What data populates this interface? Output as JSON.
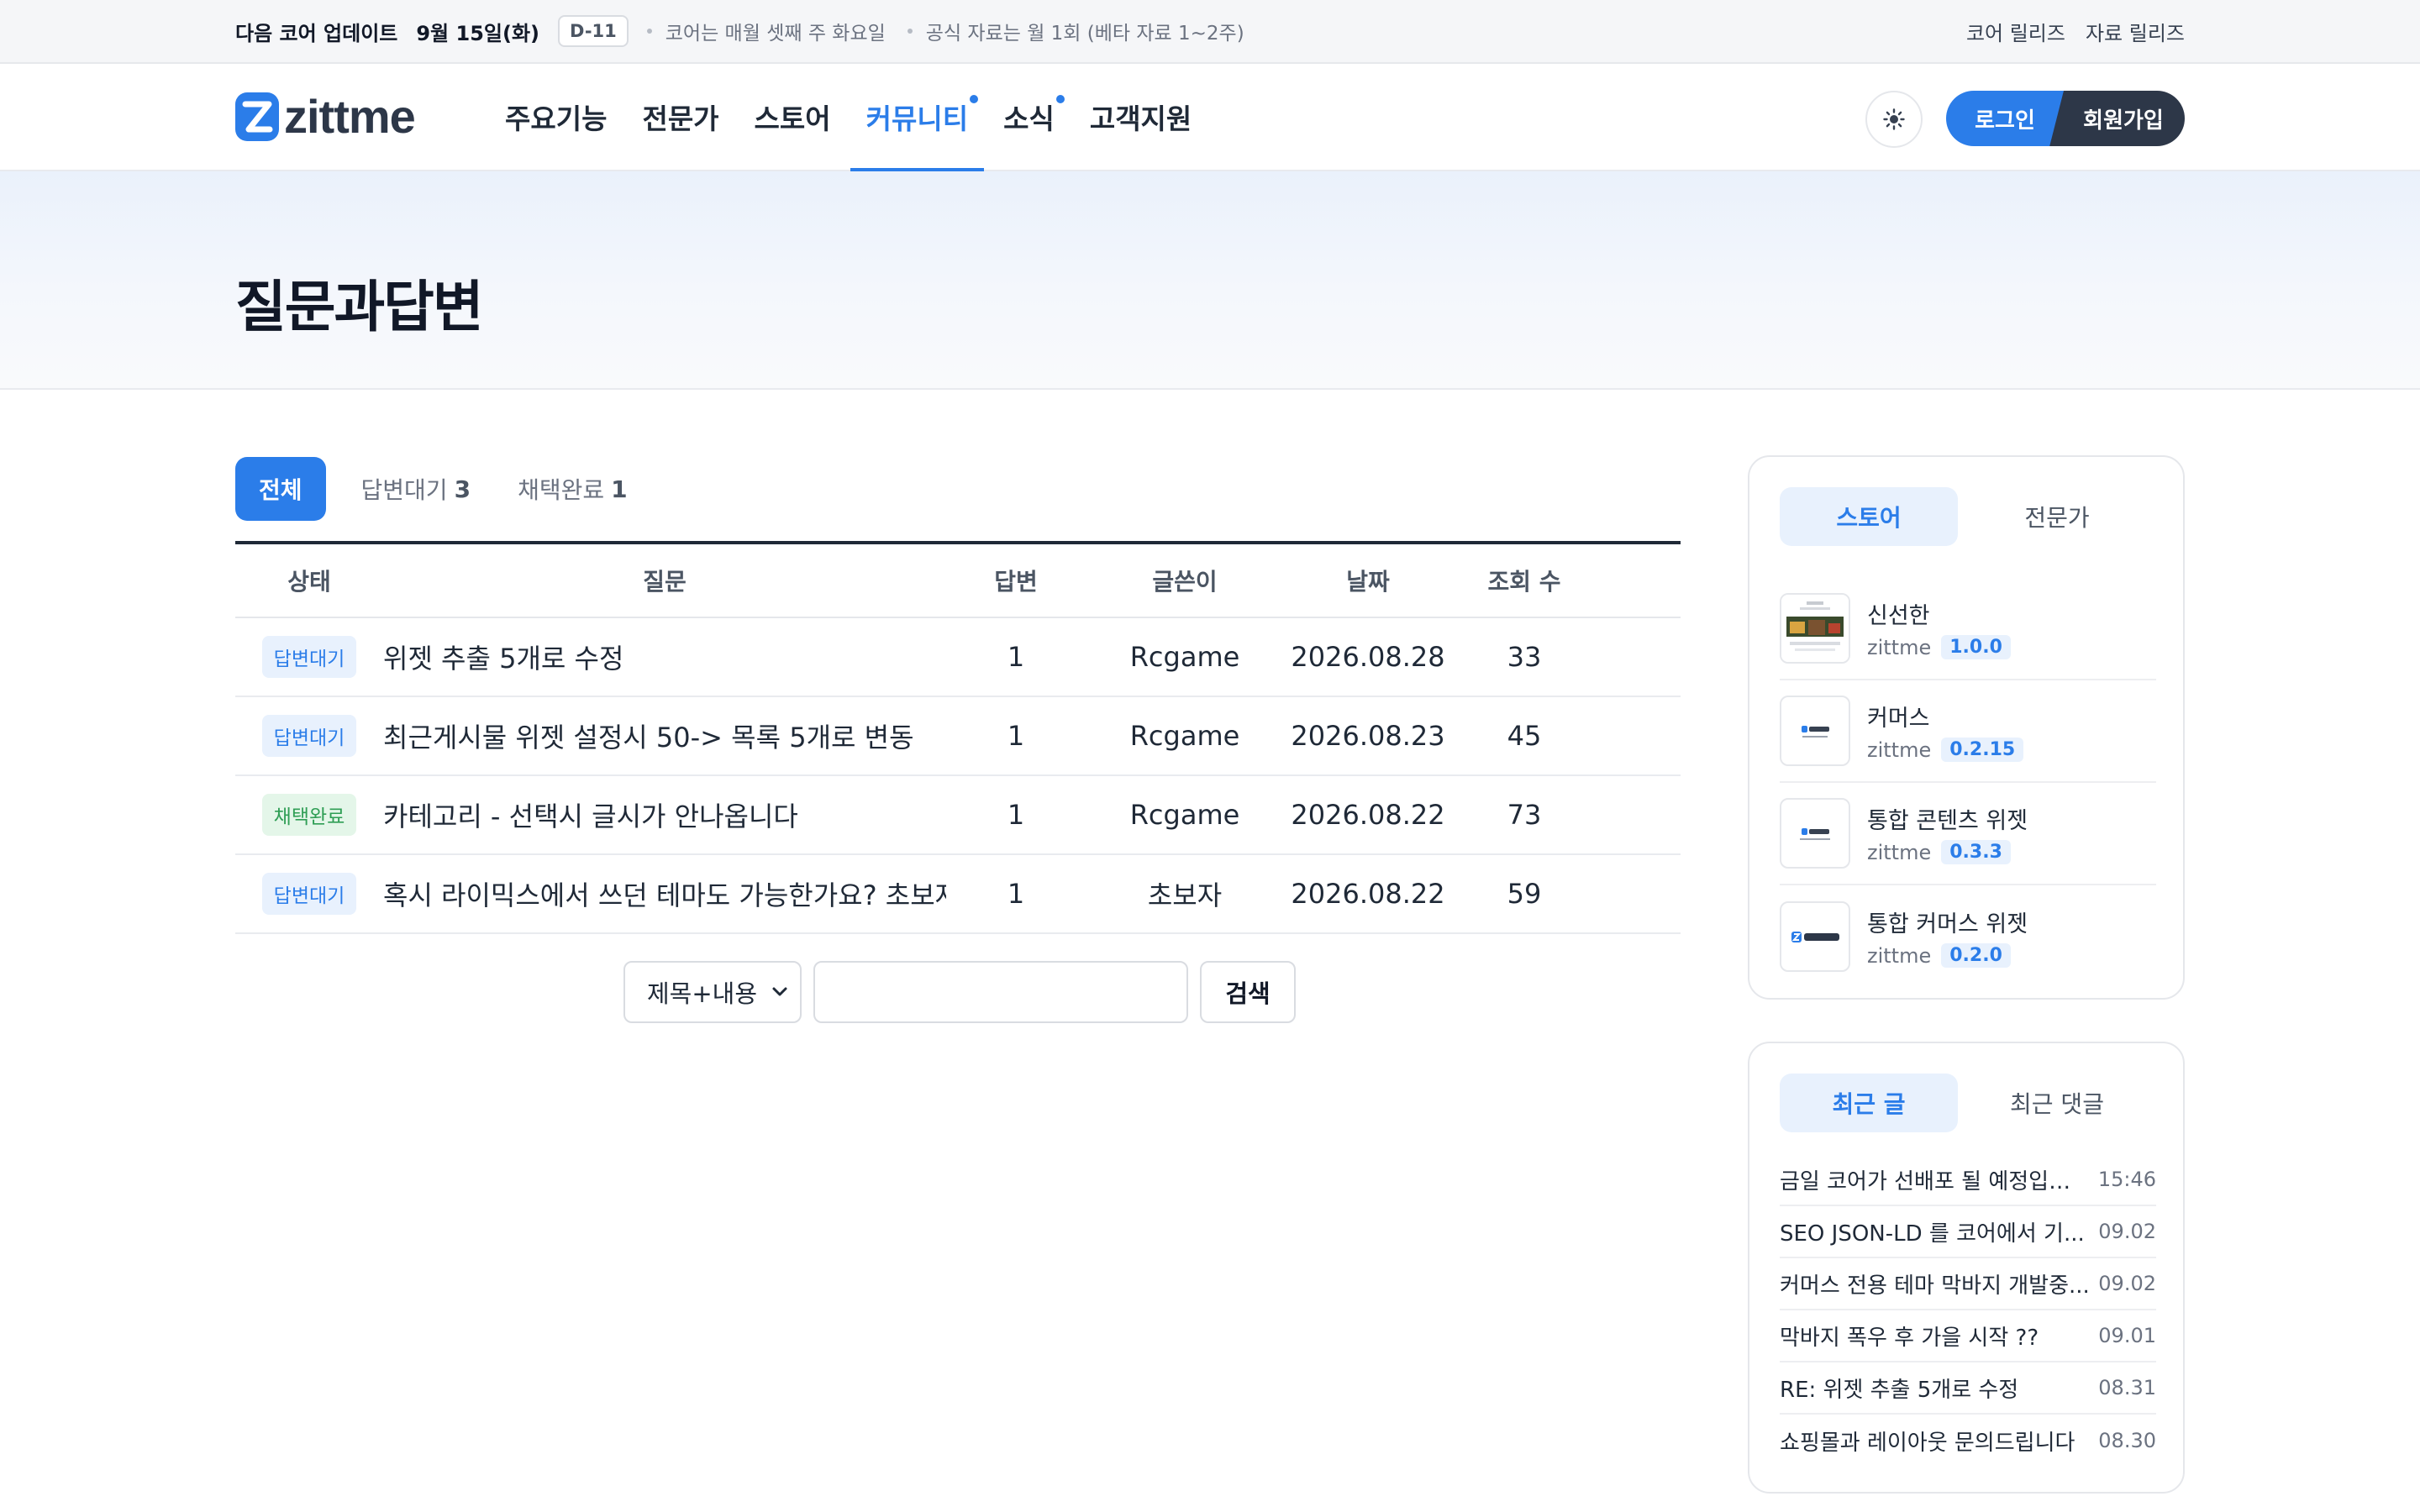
{
  "topbar": {
    "update_label": "다음 코어 업데이트",
    "update_date": "9월 15일(화)",
    "dday": "D-11",
    "notes": [
      "코어는 매월 셋째 주 화요일",
      "공식 자료는 월 1회 (베타 자료 1~2주)"
    ],
    "links": [
      "코어 릴리즈",
      "자료 릴리즈"
    ]
  },
  "header": {
    "logo_text": "zittme",
    "nav": [
      {
        "label": "주요기능",
        "active": false,
        "dot": false
      },
      {
        "label": "전문가",
        "active": false,
        "dot": false
      },
      {
        "label": "스토어",
        "active": false,
        "dot": false
      },
      {
        "label": "커뮤니티",
        "active": true,
        "dot": true
      },
      {
        "label": "소식",
        "active": false,
        "dot": true
      },
      {
        "label": "고객지원",
        "active": false,
        "dot": false
      }
    ],
    "login_label": "로그인",
    "join_label": "회원가입"
  },
  "page_title": "질문과답변",
  "tabs": [
    {
      "label": "전체",
      "count": ""
    },
    {
      "label": "답변대기",
      "count": "3"
    },
    {
      "label": "채택완료",
      "count": "1"
    }
  ],
  "table": {
    "headers": {
      "status": "상태",
      "question": "질문",
      "answers": "답변",
      "author": "글쓴이",
      "date": "날짜",
      "views": "조회 수"
    },
    "rows": [
      {
        "status": "답변대기",
        "status_type": "wait",
        "question": "위젯 추출 5개로 수정",
        "answers": "1",
        "author": "Rcgame",
        "date": "2026.08.28",
        "views": "33"
      },
      {
        "status": "답변대기",
        "status_type": "wait",
        "question": "최근게시물 위젯 설정시 50-> 목록 5개로 변동",
        "answers": "1",
        "author": "Rcgame",
        "date": "2026.08.23",
        "views": "45"
      },
      {
        "status": "채택완료",
        "status_type": "done",
        "question": "카테고리 - 선택시 글시가 안나옵니다",
        "answers": "1",
        "author": "Rcgame",
        "date": "2026.08.22",
        "views": "73"
      },
      {
        "status": "답변대기",
        "status_type": "wait",
        "question": "혹시 라이믹스에서 쓰던 테마도 가능한가요? 초보자라",
        "answers": "1",
        "author": "초보자",
        "date": "2026.08.22",
        "views": "59"
      }
    ]
  },
  "search": {
    "scope": "제목+내용",
    "query": "",
    "button": "검색"
  },
  "sidebar": {
    "store_tabs": [
      "스토어",
      "전문가"
    ],
    "store_items": [
      {
        "name": "신선한",
        "vendor": "zittme",
        "version": "1.0.0"
      },
      {
        "name": "커머스",
        "vendor": "zittme",
        "version": "0.2.15"
      },
      {
        "name": "통합 콘텐츠 위젯",
        "vendor": "zittme",
        "version": "0.3.3"
      },
      {
        "name": "통합 커머스 위젯",
        "vendor": "zittme",
        "version": "0.2.0"
      }
    ],
    "recent_tabs": [
      "최근 글",
      "최근 댓글"
    ],
    "recent_items": [
      {
        "title": "금일 코어가 선배포 될 예정입니다.",
        "date": "15:46"
      },
      {
        "title": "SEO JSON-LD 를 코어에서 기...",
        "date": "09.02"
      },
      {
        "title": "커머스 전용 테마 막바지 개발중...",
        "date": "09.02"
      },
      {
        "title": "막바지 폭우 후 가을 시작 ??",
        "date": "09.01"
      },
      {
        "title": "RE: 위젯 추출 5개로 수정",
        "date": "08.31"
      },
      {
        "title": "쇼핑몰과 레이아웃 문의드립니다",
        "date": "08.30"
      }
    ]
  },
  "colors": {
    "accent": "#2b7de9",
    "dark": "#2d3748",
    "done_green": "#2f9e55"
  }
}
